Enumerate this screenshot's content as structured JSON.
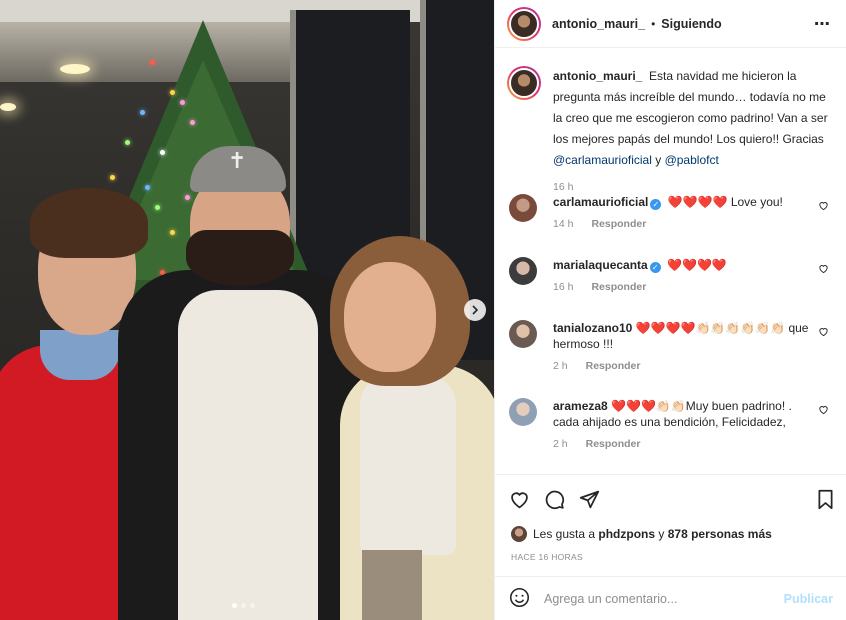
{
  "post": {
    "username": "antonio_mauri_",
    "separator": "•",
    "follow_status": "Siguiendo",
    "more_icon": "⋯"
  },
  "caption": {
    "username": "antonio_mauri_",
    "text": "Esta navidad me hicieron la pregunta más increíble del mundo… todavía no me la creo que me escogieron como padrino! Van a ser los mejores papás del mundo! Los quiero!! Gracias",
    "mention1": "@carlamaurioficial",
    "connector": "y",
    "mention2": "@pablofct",
    "time": "16 h"
  },
  "comments": [
    {
      "username": "carlamaurioficial",
      "verified": true,
      "text": "❤️❤️❤️❤️ Love you!",
      "time": "14 h",
      "reply": "Responder",
      "avatar_color": "#7a4a3a"
    },
    {
      "username": "marialaquecanta",
      "verified": true,
      "text": "❤️❤️❤️❤️",
      "time": "16 h",
      "reply": "Responder",
      "avatar_color": "#3c3c3c"
    },
    {
      "username": "tanialozano10",
      "verified": false,
      "text": "❤️❤️❤️❤️👏🏻👏🏻👏🏻👏🏻👏🏻👏🏻 que hermoso !!!",
      "time": "2 h",
      "reply": "Responder",
      "avatar_color": "#6b5a52"
    },
    {
      "username": "arameza8",
      "verified": false,
      "text": "❤️❤️❤️👏🏻👏🏻Muy buen padrino! . cada ahijado es una bendición, Felicidadez,",
      "time": "2 h",
      "reply": "Responder",
      "avatar_color": "#8fa0b4"
    }
  ],
  "likes": {
    "prefix": "Les gusta a",
    "user": "phdzpons",
    "connector": "y",
    "others": "878 personas más"
  },
  "timestamp": "HACE 16 HORAS",
  "add_comment": {
    "placeholder": "Agrega un comentario...",
    "post_label": "Publicar"
  },
  "colors": {
    "link": "#00376b",
    "verified": "#3897f0",
    "heart": "#ed4956",
    "publish_disabled": "#b2dffc"
  },
  "carousel": {
    "total": 3,
    "active": 1
  }
}
